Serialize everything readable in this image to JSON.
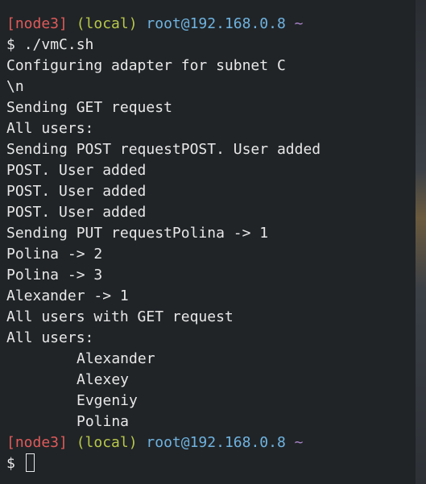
{
  "prompt": {
    "node": "[node3]",
    "local": "(local)",
    "userhost": "root@192.168.0.8",
    "dir": "~",
    "symbol": "$"
  },
  "command": "./vmC.sh",
  "output": [
    "Configuring adapter for subnet C",
    "\\n",
    "Sending GET request",
    "All users:",
    "Sending POST requestPOST. User added",
    "POST. User added",
    "POST. User added",
    "POST. User added",
    "Sending PUT requestPolina -> 1",
    "Polina -> 2",
    "Polina -> 3",
    "Alexander -> 1",
    "All users with GET request",
    "All users:"
  ],
  "users": [
    "Alexander",
    "Alexey",
    "Evgeniy",
    "Polina"
  ]
}
